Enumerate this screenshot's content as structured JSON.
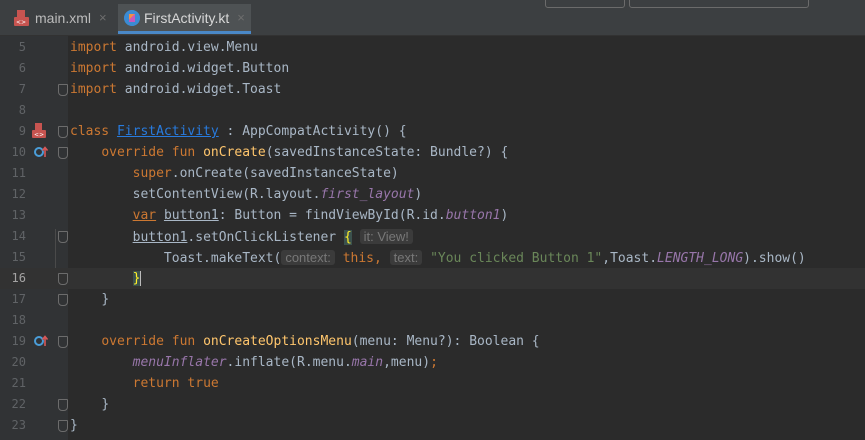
{
  "tabs": [
    {
      "label": "main.xml",
      "close": "×",
      "icon": "xml-file-icon",
      "active": false
    },
    {
      "label": "FirstActivity.kt",
      "close": "×",
      "icon": "kotlin-file-icon",
      "active": true
    }
  ],
  "editor": {
    "current_line": 16,
    "lines": [
      {
        "n": "5"
      },
      {
        "n": "6"
      },
      {
        "n": "7"
      },
      {
        "n": "8"
      },
      {
        "n": "9"
      },
      {
        "n": "10"
      },
      {
        "n": "11"
      },
      {
        "n": "12"
      },
      {
        "n": "13"
      },
      {
        "n": "14"
      },
      {
        "n": "15"
      },
      {
        "n": "16"
      },
      {
        "n": "17"
      },
      {
        "n": "18"
      },
      {
        "n": "19"
      },
      {
        "n": "20"
      },
      {
        "n": "21"
      },
      {
        "n": "22"
      },
      {
        "n": "23"
      }
    ],
    "code": {
      "l5": {
        "kw": "import",
        "rest": " android.view.Menu"
      },
      "l6": {
        "kw": "import",
        "rest": " android.widget.Button"
      },
      "l7": {
        "kw": "import",
        "rest": " android.widget.Toast"
      },
      "l9": {
        "kw": "class",
        "cls": "FirstActivity",
        "rest": " : AppCompatActivity() {"
      },
      "l10": {
        "kw": "override fun",
        "fn": "onCreate",
        "rest": "(savedInstanceState: Bundle?) {"
      },
      "l11": {
        "kw": "super",
        "rest": ".onCreate(savedInstanceState)"
      },
      "l12": {
        "a": "setContentView(R.layout.",
        "it": "first_layout",
        "b": ")"
      },
      "l13": {
        "kw": "var",
        "ul": "button1",
        "a": ": Button = findViewById(R.id.",
        "it": "button1",
        "b": ")"
      },
      "l14": {
        "ul": "button1",
        "a": ".setOnClickListener ",
        "brace": "{",
        "hint": "it: View!"
      },
      "l15": {
        "a": "Toast.makeText(",
        "hint1": "context:",
        "kw": "this,",
        "hint2": "text:",
        "str": "\"You clicked Button 1\"",
        "b": ",Toast.",
        "it": "LENGTH_LONG",
        "c": ").show()"
      },
      "l16": {
        "brace": "}"
      },
      "l17": {
        "a": "}"
      },
      "l19": {
        "kw": "override fun",
        "fn": "onCreateOptionsMenu",
        "rest": "(menu: Menu?): ",
        "kw2": "Boolean",
        "rest2": " {"
      },
      "l20": {
        "it": "menuInflater",
        "a": ".inflate(R.menu.",
        "it2": "main",
        "b": ",menu)",
        "semi": ";"
      },
      "l21": {
        "kw": "return true"
      },
      "l22": {
        "a": "}"
      },
      "l23": {
        "a": "}"
      }
    }
  },
  "colors": {
    "background": "#2b2b2b",
    "gutter": "#313335",
    "keyword": "#cc7832",
    "function": "#ffc66d",
    "string": "#6a8759",
    "italic_field": "#9876aa",
    "class_link": "#287bde"
  }
}
